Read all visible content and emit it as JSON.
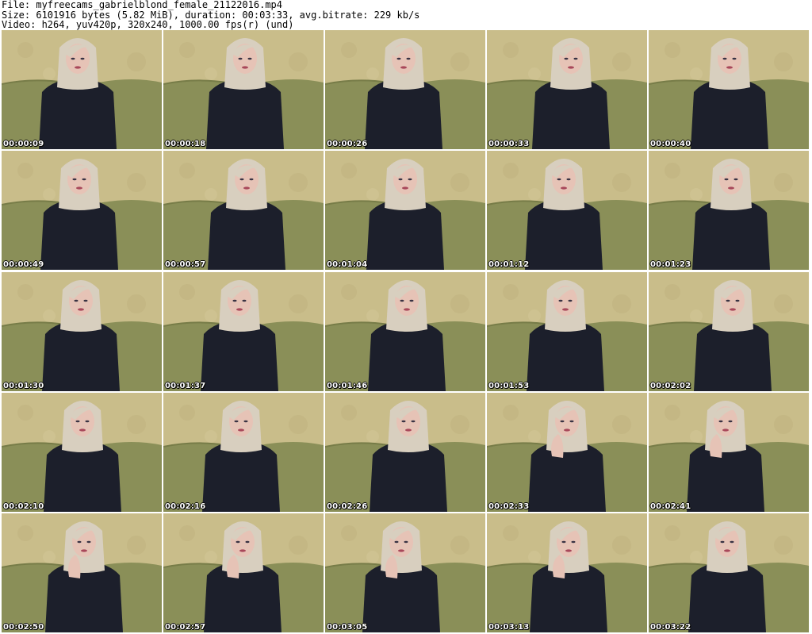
{
  "header": {
    "file_line": "File: myfreecams_gabrielblond_female_21122016.mp4",
    "size_line": "Size: 6101916 bytes (5.82 MiB), duration: 00:03:33, avg.bitrate: 229 kb/s",
    "video_line": "Video: h264, yuv420p, 320x240, 1000.00 fps(r) (und)"
  },
  "colors": {
    "wallpaper": "#c9bd8a",
    "sofa": "#8a8f58",
    "sweater": "#1c1f2b",
    "hair": "#d8cfbf",
    "skin": "#e6c3b6",
    "lips": "#a8485a"
  },
  "thumbnails": [
    {
      "timestamp": "00:00:09",
      "hand": false
    },
    {
      "timestamp": "00:00:18",
      "hand": false
    },
    {
      "timestamp": "00:00:26",
      "hand": false
    },
    {
      "timestamp": "00:00:33",
      "hand": false
    },
    {
      "timestamp": "00:00:40",
      "hand": false
    },
    {
      "timestamp": "00:00:49",
      "hand": false
    },
    {
      "timestamp": "00:00:57",
      "hand": false
    },
    {
      "timestamp": "00:01:04",
      "hand": false
    },
    {
      "timestamp": "00:01:12",
      "hand": false
    },
    {
      "timestamp": "00:01:23",
      "hand": false
    },
    {
      "timestamp": "00:01:30",
      "hand": false
    },
    {
      "timestamp": "00:01:37",
      "hand": false
    },
    {
      "timestamp": "00:01:46",
      "hand": false
    },
    {
      "timestamp": "00:01:53",
      "hand": false
    },
    {
      "timestamp": "00:02:02",
      "hand": false
    },
    {
      "timestamp": "00:02:10",
      "hand": false
    },
    {
      "timestamp": "00:02:16",
      "hand": false
    },
    {
      "timestamp": "00:02:26",
      "hand": false
    },
    {
      "timestamp": "00:02:33",
      "hand": true
    },
    {
      "timestamp": "00:02:41",
      "hand": true
    },
    {
      "timestamp": "00:02:50",
      "hand": true
    },
    {
      "timestamp": "00:02:57",
      "hand": true
    },
    {
      "timestamp": "00:03:05",
      "hand": true
    },
    {
      "timestamp": "00:03:13",
      "hand": true
    },
    {
      "timestamp": "00:03:22",
      "hand": false
    }
  ]
}
